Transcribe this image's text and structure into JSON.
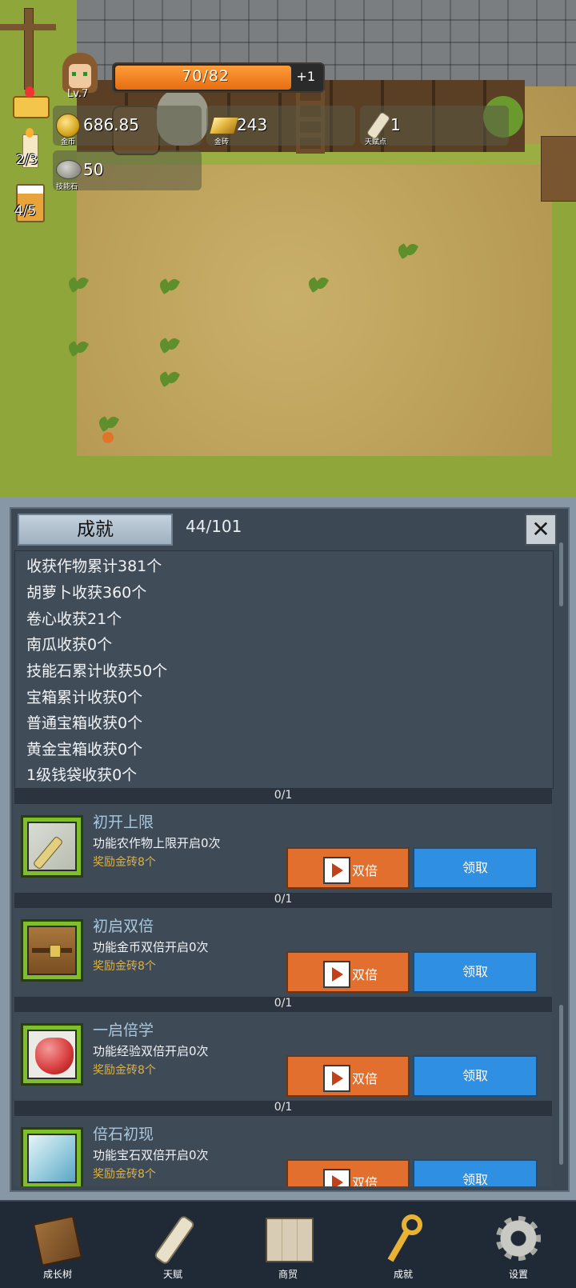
{
  "hud": {
    "level": "Lv.7",
    "hp_text": "70/82",
    "hp_fraction": 0.8537,
    "hp_plus": "+1",
    "resources": [
      {
        "name": "gold",
        "value": "686.85",
        "caption": "金币"
      },
      {
        "name": "goldbar",
        "value": "243",
        "caption": "金砖"
      },
      {
        "name": "talent",
        "value": "1",
        "caption": "天赋点"
      },
      {
        "name": "skillstone",
        "value": "50",
        "caption": "技能石"
      }
    ],
    "side": [
      {
        "name": "crown",
        "value": ""
      },
      {
        "name": "candle",
        "value": "2/3"
      },
      {
        "name": "beer",
        "value": "4/5"
      }
    ]
  },
  "panel": {
    "tab": "成就",
    "count": "44/101",
    "close": "✕",
    "stats": [
      "收获作物累计381个",
      "胡萝卜收获360个",
      "卷心收获21个",
      "南瓜收获0个",
      "技能石累计收获50个",
      "宝箱累计收获0个",
      "普通宝箱收获0个",
      "黄金宝箱收获0个",
      "1级钱袋收获0个"
    ],
    "achievements": [
      {
        "progress": "0/1",
        "title": "初开上限",
        "desc": "功能农作物上限开启0次",
        "reward": "奖励金砖8个",
        "icon": "scroll-icon"
      },
      {
        "progress": "0/1",
        "title": "初启双倍",
        "desc": "功能金币双倍开启0次",
        "reward": "奖励金砖8个",
        "icon": "chest-icon"
      },
      {
        "progress": "0/1",
        "title": "一启倍学",
        "desc": "功能经验双倍开启0次",
        "reward": "奖励金砖8个",
        "icon": "heart-icon"
      },
      {
        "progress": "0/1",
        "title": "倍石初现",
        "desc": "功能宝石双倍开启0次",
        "reward": "奖励金砖8个",
        "icon": "crystal-icon"
      }
    ],
    "double_label": "双倍",
    "claim_label": "领取"
  },
  "nav": [
    {
      "label": "成长树",
      "icon": "book-icon"
    },
    {
      "label": "天赋",
      "icon": "scroll-icon"
    },
    {
      "label": "商贸",
      "icon": "map-icon"
    },
    {
      "label": "成就",
      "icon": "key-icon"
    },
    {
      "label": "设置",
      "icon": "gear-icon"
    }
  ],
  "colors": {
    "accent_orange": "#e26f2e",
    "accent_blue": "#2e8fe3",
    "panel_bg": "#3d4855"
  }
}
